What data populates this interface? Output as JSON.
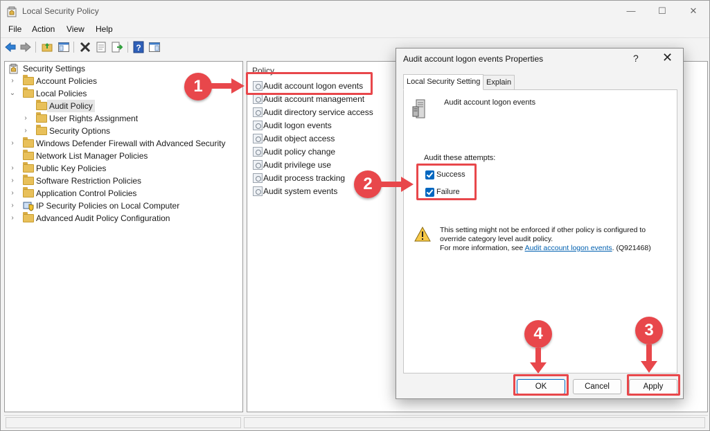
{
  "window": {
    "title": "Local Security Policy",
    "controls": {
      "minimize": "—",
      "maximize": "☐",
      "close": "✕"
    }
  },
  "menu": [
    "File",
    "Action",
    "View",
    "Help"
  ],
  "toolbar": {
    "icons": [
      "back-icon",
      "forward-icon",
      "up-folder-icon",
      "show-hide-tree-icon",
      "delete-icon",
      "properties-icon",
      "export-list-icon",
      "help-icon",
      "show-hide-action-pane-icon"
    ]
  },
  "tree": {
    "items": [
      {
        "label": "Security Settings"
      },
      {
        "label": "Account Policies"
      },
      {
        "label": "Local Policies"
      },
      {
        "label": "Audit Policy"
      },
      {
        "label": "User Rights Assignment"
      },
      {
        "label": "Security Options"
      },
      {
        "label": "Windows Defender Firewall with Advanced Security"
      },
      {
        "label": "Network List Manager Policies"
      },
      {
        "label": "Public Key Policies"
      },
      {
        "label": "Software Restriction Policies"
      },
      {
        "label": "Application Control Policies"
      },
      {
        "label": "IP Security Policies on Local Computer"
      },
      {
        "label": "Advanced Audit Policy Configuration"
      }
    ]
  },
  "policy_list": {
    "column_header": "Policy",
    "items": [
      "Audit account logon events",
      "Audit account management",
      "Audit directory service access",
      "Audit logon events",
      "Audit object access",
      "Audit policy change",
      "Audit privilege use",
      "Audit process tracking",
      "Audit system events"
    ]
  },
  "dialog": {
    "title": "Audit account logon events Properties",
    "help": "?",
    "close": "✕",
    "tabs": [
      "Local Security Setting",
      "Explain"
    ],
    "policy_name": "Audit account logon events",
    "audit_label": "Audit these attempts:",
    "checkboxes": [
      {
        "label": "Success",
        "checked": true
      },
      {
        "label": "Failure",
        "checked": true
      }
    ],
    "warning_line1": "This setting might not be enforced if other policy is configured to",
    "warning_line2": "override category level audit policy.",
    "warning_line3_prefix": "For more information, see ",
    "warning_link": "Audit account logon events",
    "warning_suffix": ". (Q921468)",
    "buttons": {
      "ok": "OK",
      "cancel": "Cancel",
      "apply": "Apply"
    }
  },
  "annotations": {
    "steps": [
      "1",
      "2",
      "3",
      "4"
    ],
    "accent_color": "#e8474b"
  }
}
